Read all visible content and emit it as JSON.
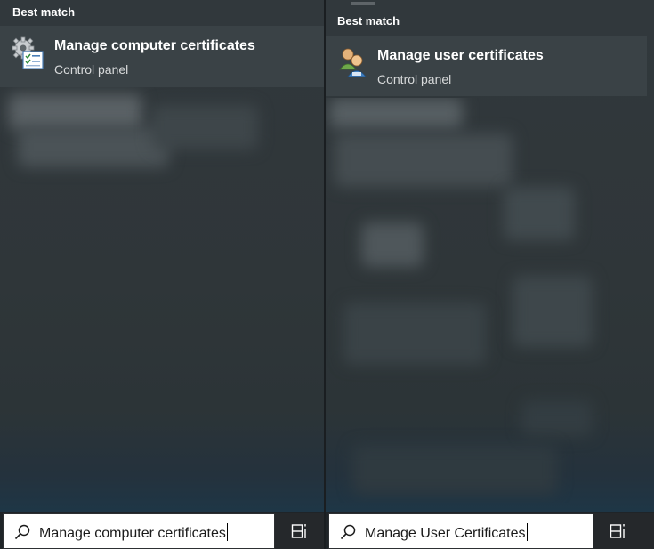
{
  "left_panel": {
    "section_heading": "Best match",
    "best_match": {
      "icon": "computer-certificates-icon",
      "title": "Manage computer certificates",
      "subtitle": "Control panel"
    },
    "search": {
      "icon": "search-icon",
      "value": "Manage computer certificates"
    },
    "taskview_icon": "task-view-icon"
  },
  "right_panel": {
    "section_heading": "Best match",
    "best_match": {
      "icon": "user-certificates-icon",
      "title": "Manage user certificates",
      "subtitle": "Control panel"
    },
    "search": {
      "icon": "search-icon",
      "value": "Manage User Certificates"
    },
    "taskview_icon": "task-view-icon"
  },
  "colors": {
    "menu_background": "#2f3639",
    "best_match_highlight": "#3a4246",
    "taskbar": "#25282b",
    "search_box": "#ffffff"
  }
}
